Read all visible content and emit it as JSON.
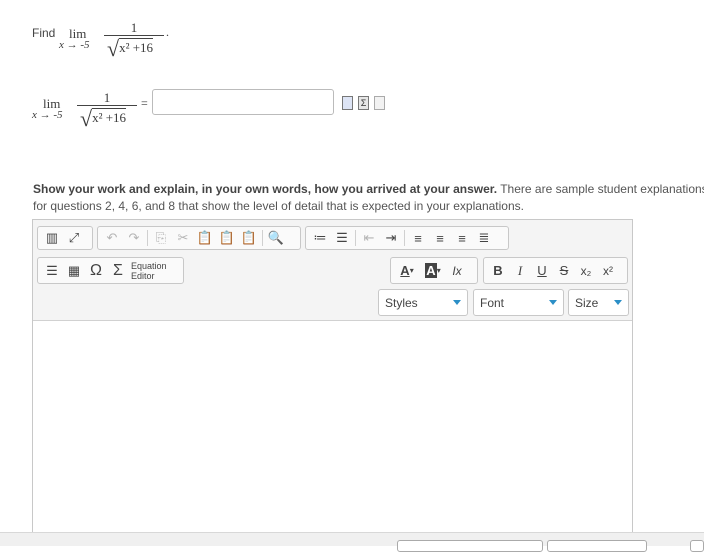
{
  "question": {
    "find_label": "Find",
    "lim_word": "lim",
    "lim_sub": "x → -5",
    "numerator": "1",
    "radicand": "x² +16",
    "period": ".",
    "equals": "="
  },
  "answer": {
    "value": "",
    "placeholder": ""
  },
  "answer_tools": [
    "preview-icon",
    "sigma-icon",
    "help-icon"
  ],
  "instructions": {
    "bold": "Show your work and explain, in your own words, how you arrived at your answer.",
    "rest": " There are sample student explanations for questions 2, 4, 6, and 8 that show the level of detail that is expected in your explanations."
  },
  "editor": {
    "equation_editor_line1": "Equation",
    "equation_editor_line2": "Editor",
    "styles_label": "Styles",
    "font_label": "Font",
    "size_label": "Size",
    "font_color_glyph": "A",
    "bg_color_glyph": "A",
    "clear_format_glyph": "Ix",
    "bold_glyph": "B",
    "italic_glyph": "I",
    "underline_glyph": "U",
    "strike_glyph": "S",
    "subscript_glyph": "x₂",
    "superscript_glyph": "x²",
    "omega_glyph": "Ω",
    "sigma_glyph": "Σ",
    "body_text": ""
  },
  "colors": {
    "accent": "#2b8fc7",
    "toolbar_bg": "#f4f4f4",
    "border": "#c8c8c8"
  }
}
